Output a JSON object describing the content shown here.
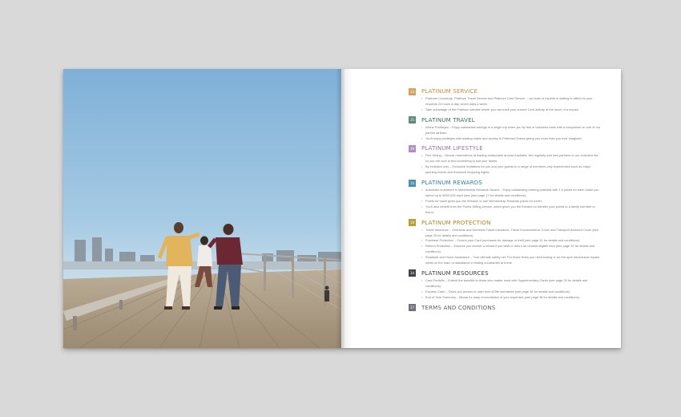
{
  "brochure": {
    "sections": [
      {
        "number": "33",
        "title": "PLATINUM SERVICE",
        "color": "#d4a15f",
        "items": [
          "Platinum Concierge, Platinum Travel Service and Platinum Card Service – our team of experts is waiting to attend to your requests 24 hours a day, seven days a week.",
          "Take advantage of the Platinum website where you can track your current Card activity at the touch of a mouse."
        ]
      },
      {
        "number": "35",
        "title": "PLATINUM TRAVEL",
        "color": "#5c8a7c",
        "items": [
          "Airline Privileges – Enjoy substantial savings in a single trip when you fly first or business class with a companion on one of our partner airlines.",
          "You'll enjoy privileges with leading hotels and access to Preferred Extras giving you more than you ever imagined."
        ]
      },
      {
        "number": "39",
        "title": "PLATINUM LIFESTYLE",
        "color": "#b08cc0",
        "items": [
          "Fine Dining – Secure reservations at leading restaurants around Australia. We regularly add new partners to our exclusive list, so you are sure to find something to suit your tastes.",
          "By invitation only – Exclusive invitations for you and your guests to a range of members-only experiences such as major sporting events and exclusive shopping nights."
        ]
      },
      {
        "number": "14",
        "title": "PLATINUM REWARDS",
        "color": "#4a90b0",
        "items": [
          "Automatic enrolment in Membership Rewards' Ascent – Enjoy outstanding earning potential with 1.5 points for each dollar you spend up to $200,000 each year (see page 17 for details and conditions).",
          "Points for travel gives you the freedom to use Membership Rewards points for travel.",
          "You'll also benefit from the Points Gifting service, which gives you the freedom to transfer your points to a family member or friend."
        ]
      },
      {
        "number": "18",
        "title": "PLATINUM PROTECTION",
        "color": "#b8a030",
        "items": [
          "Travel Insurance – Overseas and Domestic Travel Insurance, Travel Inconvenience Cover and Transport Accident Cover (see page 29 for details and conditions).",
          "Purchase Protection – Covers your Card purchases for damage or theft (see page 31 for details and conditions).",
          "Refund Protection – Ensures you receive a refund if you wish to return an unused eligible item (see page 32 for details and conditions).",
          "Roadside and Home Assistance – Your ultimate safety net. For those times you need towing or on-the-spot mechanical repairs whilst on the road, or assistance in finding a locksmith at home."
        ]
      },
      {
        "number": "34",
        "title": "PLATINUM RESOURCES",
        "color": "#3f4348",
        "items": [
          "Card Portfolio – Extend the benefits to those who matter most with Supplementary Cards (see page 33 for details and conditions).",
          "Express Cash – Gives you access to cash from ATMs worldwide (see page 36 for details and conditions).",
          "End of Year Summary – Allows for easy reconciliation of your expenses (see page 38 for details and conditions)."
        ]
      },
      {
        "number": "37",
        "title": "TERMS AND CONDITIONS",
        "color": "#6e7176",
        "items": []
      }
    ]
  }
}
